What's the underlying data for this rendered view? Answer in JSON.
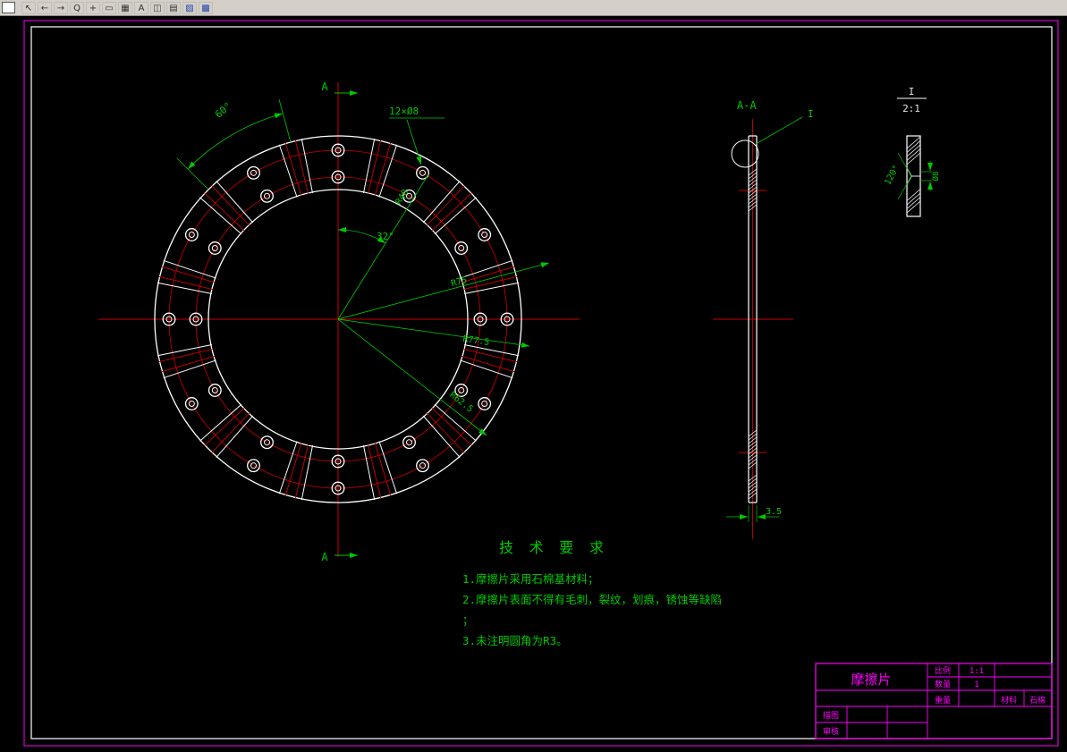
{
  "window": {
    "toolbar_icons": [
      {
        "name": "select-tool-icon",
        "glyph": "↖",
        "color": "#333333"
      },
      {
        "name": "undo-icon",
        "glyph": "←",
        "color": "#333333"
      },
      {
        "name": "redo-icon",
        "glyph": "→",
        "color": "#333333"
      },
      {
        "name": "zoom-tool-icon",
        "glyph": "Q",
        "color": "#333333"
      },
      {
        "name": "pan-tool-icon",
        "glyph": "+",
        "color": "#333333"
      },
      {
        "name": "rectangle-tool-icon",
        "glyph": "▭",
        "color": "#333333"
      },
      {
        "name": "hatch-tool-icon",
        "glyph": "▦",
        "color": "#333333"
      },
      {
        "name": "text-tool-icon",
        "glyph": "A",
        "color": "#333333"
      },
      {
        "name": "layout-icon",
        "glyph": "◫",
        "color": "#333333"
      },
      {
        "name": "layers-icon",
        "glyph": "▤",
        "color": "#333333"
      },
      {
        "name": "grid-toggle-icon",
        "glyph": "▨",
        "color": "#2244aa"
      },
      {
        "name": "osnap-toggle-icon",
        "glyph": "▩",
        "color": "#2244aa"
      }
    ]
  },
  "front_view": {
    "section_letter": "A",
    "dim_angle_60": "60°",
    "dim_holes": "12×Ø8",
    "dim_angle_32": "32°",
    "dim_r48": "R48",
    "dim_r75": "R75",
    "dim_r77": "R77.5",
    "dim_r62": "R62.5"
  },
  "section_view": {
    "title": "A-A",
    "detail_mark": "I",
    "thickness_dim": "3.5"
  },
  "detail_view": {
    "mark": "I",
    "scale": "2:1",
    "angle_dim": "120°",
    "dia_dim": "Ø8"
  },
  "tech_requirements": {
    "title": "技 术 要 求",
    "lines": [
      "1.摩擦片采用石棉基材料；",
      "2.摩擦片表面不得有毛刺，裂纹，划痕，锈蚀等缺陷",
      "；",
      "3.未注明圆角为R3。"
    ]
  },
  "title_block": {
    "part_name": "摩擦片",
    "scale_label": "比例",
    "scale_value": "1:1",
    "qty_label": "数量",
    "qty_value": "1",
    "weight_label": "重量",
    "material_label": "材料",
    "material_value": "石棉",
    "row_tracing_label": "描图",
    "row_check_label": "审核"
  },
  "colors": {
    "background": "#000000",
    "toolbar_bg": "#d4d0c8",
    "outline_white": "#ffffff",
    "centerline_red": "#cd0000",
    "annotation_green": "#00c800",
    "title_block_magenta": "#ff00ff"
  }
}
